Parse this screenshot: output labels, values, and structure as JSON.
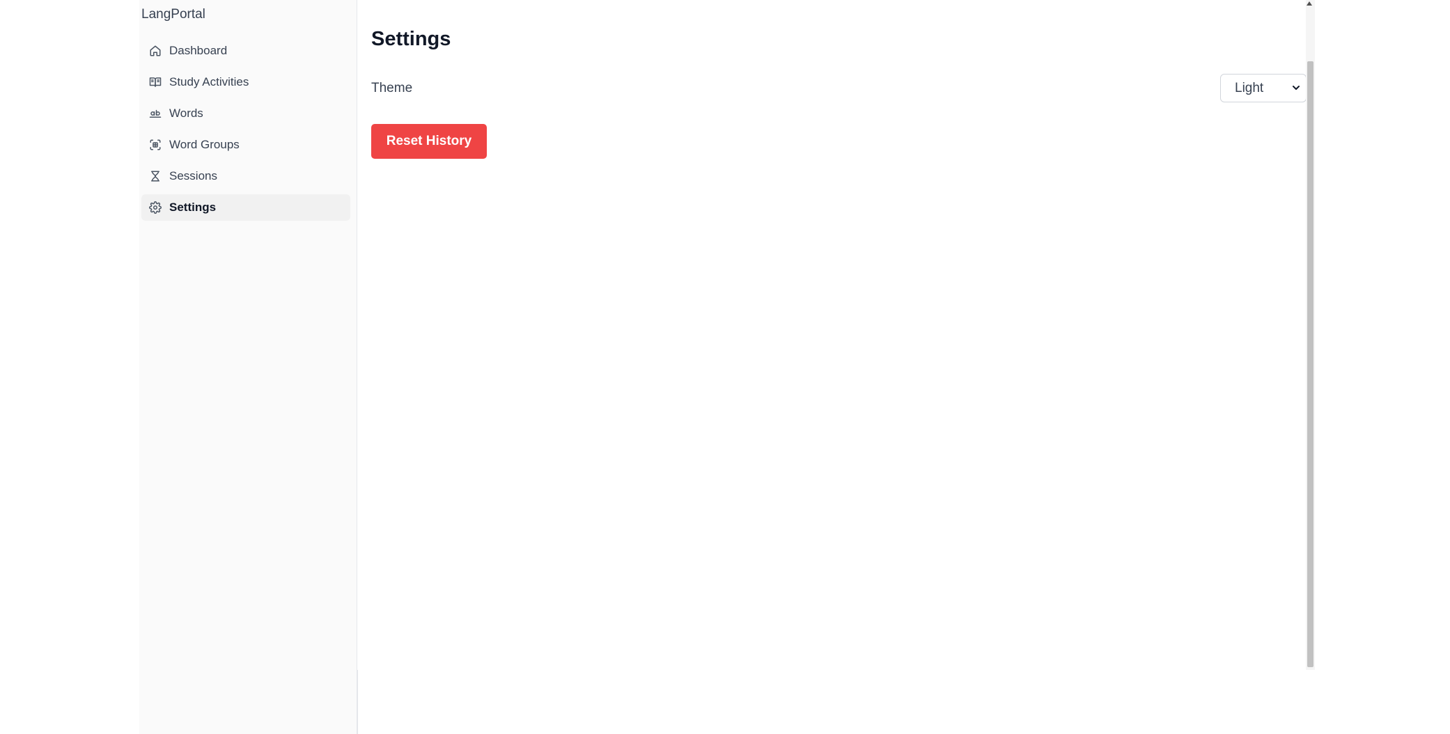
{
  "app": {
    "title": "LangPortal"
  },
  "sidebar": {
    "items": [
      {
        "label": "Dashboard",
        "icon": "home-icon",
        "active": false
      },
      {
        "label": "Study Activities",
        "icon": "book-open-icon",
        "active": false
      },
      {
        "label": "Words",
        "icon": "text-ab-icon",
        "active": false
      },
      {
        "label": "Word Groups",
        "icon": "group-scan-icon",
        "active": false
      },
      {
        "label": "Sessions",
        "icon": "hourglass-icon",
        "active": false
      },
      {
        "label": "Settings",
        "icon": "gear-icon",
        "active": true
      }
    ]
  },
  "main": {
    "title": "Settings",
    "theme": {
      "label": "Theme",
      "selected": "Light"
    },
    "reset_button_label": "Reset History"
  },
  "colors": {
    "danger": "#ef4444",
    "sidebar_bg": "#fafafa",
    "active_item_bg": "#f1f1f1"
  }
}
